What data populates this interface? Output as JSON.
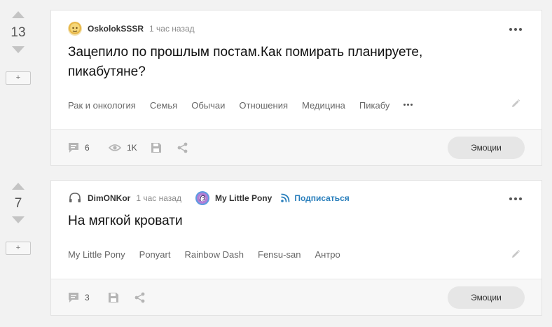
{
  "posts": [
    {
      "rating": "13",
      "plus_label": "+",
      "author": "OskolokSSSR",
      "time": "1 час назад",
      "title": "Зацепило по прошлым постам.Как помирать планируете, пикабутяне?",
      "tags": [
        "Рак и онкология",
        "Семья",
        "Обычаи",
        "Отношения",
        "Медицина",
        "Пикабу"
      ],
      "comments": "6",
      "views": "1K",
      "emotions_label": "Эмоции",
      "icons": [
        "comment-icon",
        "eye-icon",
        "save-icon",
        "share-icon",
        "more-icon",
        "pencil-icon"
      ]
    },
    {
      "rating": "7",
      "plus_label": "+",
      "author": "DimONKor",
      "time": "1 час назад",
      "community": "My Little Pony",
      "subscribe_label": "Подписаться",
      "title": "На мягкой кровати",
      "tags": [
        "My Little Pony",
        "Ponyart",
        "Rainbow Dash",
        "Fensu-san",
        "Антро"
      ],
      "comments": "3",
      "emotions_label": "Эмоции",
      "icons": [
        "comment-icon",
        "save-icon",
        "share-icon",
        "more-icon",
        "pencil-icon"
      ]
    }
  ],
  "colors": {
    "background": "#f2f2f2",
    "card": "#ffffff",
    "footer": "#f7f7f7",
    "accent_subscribe": "#2a7fbc",
    "vote_arrow": "#c4c4c4"
  }
}
